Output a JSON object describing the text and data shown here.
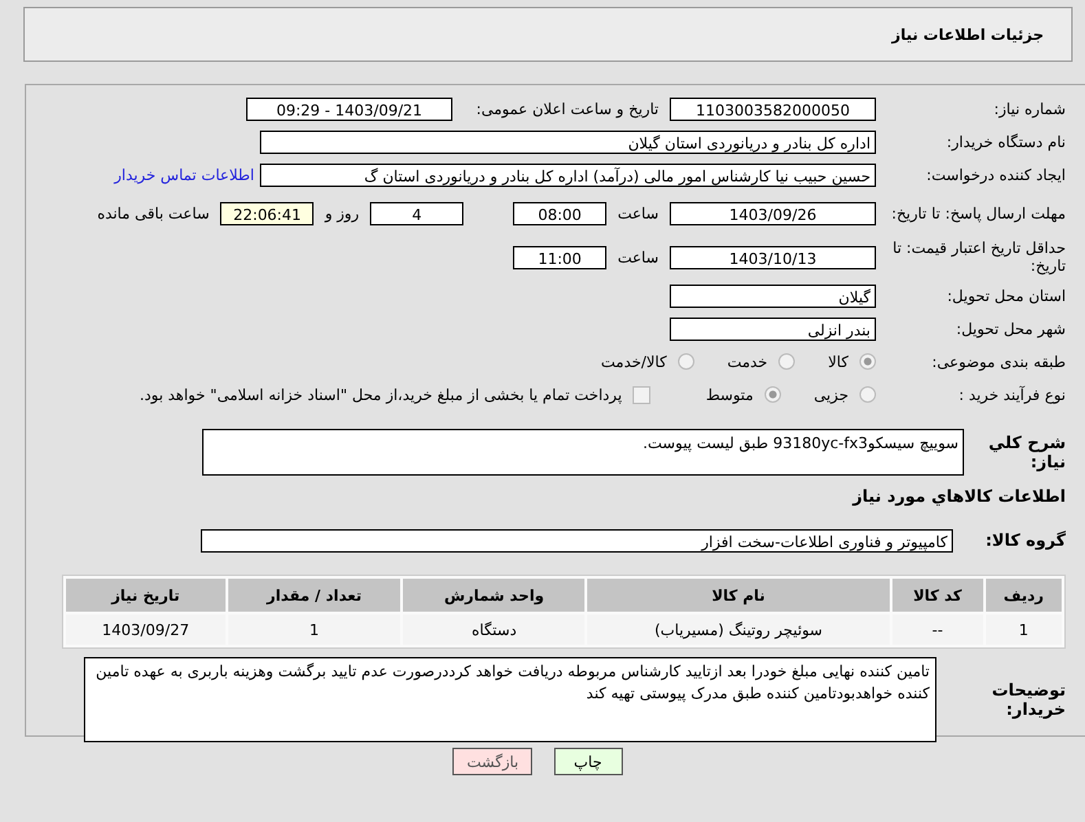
{
  "header": {
    "title": "جزئیات اطلاعات نیاز"
  },
  "fields": {
    "need_number": {
      "label": "شماره نیاز:",
      "value": "1103003582000050"
    },
    "announce": {
      "label": "تاریخ و ساعت اعلان عمومی:",
      "value": "1403/09/21 - 09:29"
    },
    "buyer_org": {
      "label": "نام دستگاه خریدار:",
      "value": "اداره کل بنادر و دریانوردی استان گیلان"
    },
    "creator": {
      "label": "ایجاد کننده درخواست:",
      "value": "حسین حبیب نیا کارشناس امور مالی (درآمد) اداره کل بنادر و دریانوردی استان گ",
      "link": "اطلاعات تماس خریدار"
    },
    "deadline": {
      "label": "مهلت ارسال پاسخ: تا تاریخ:",
      "date": "1403/09/26",
      "time_label": "ساعت",
      "time": "08:00",
      "days": "4",
      "days_label": "روز و",
      "remaining": "22:06:41",
      "remaining_label": "ساعت باقی مانده"
    },
    "validity": {
      "label": "حداقل تاریخ اعتبار قیمت: تا تاریخ:",
      "date": "1403/10/13",
      "time_label": "ساعت",
      "time": "11:00"
    },
    "province": {
      "label": "استان محل تحویل:",
      "value": "گیلان"
    },
    "city": {
      "label": "شهر محل تحویل:",
      "value": "بندر انزلی"
    }
  },
  "category": {
    "label": "طبقه بندی موضوعی:",
    "options": [
      {
        "label": "کالا",
        "selected": true
      },
      {
        "label": "خدمت",
        "selected": false
      },
      {
        "label": "کالا/خدمت",
        "selected": false
      }
    ]
  },
  "process": {
    "label": "نوع فرآیند خرید :",
    "options": [
      {
        "label": "جزیی",
        "selected": false
      },
      {
        "label": "متوسط",
        "selected": true
      }
    ],
    "payment": {
      "label": "پرداخت تمام یا بخشی از مبلغ خرید،از محل \"اسناد خزانه اسلامی\" خواهد بود.",
      "checked": false
    }
  },
  "description": {
    "label": "شرح کلي نياز:",
    "value": "سوییچ سیسکو93180yc-fx3 طبق لیست پیوست."
  },
  "goods_heading": "اطلاعات کالاهاي مورد نياز",
  "goods_group": {
    "label": "گروه کالا:",
    "value": "کامپیوتر و فناوری اطلاعات-سخت افزار"
  },
  "table": {
    "columns": [
      "ردیف",
      "کد کالا",
      "نام کالا",
      "واحد شمارش",
      "تعداد / مقدار",
      "تاریخ نیاز"
    ],
    "rows": [
      [
        "1",
        "--",
        "سوئیچر روتینگ (مسیریاب)",
        "دستگاه",
        "1",
        "1403/09/27"
      ]
    ]
  },
  "buyer_notes": {
    "label": "توضیحات خریدار:",
    "value": "تامین کننده نهایی مبلغ خودرا بعد ازتایید کارشناس مربوطه دریافت خواهد کرددرصورت عدم تایید برگشت وهزینه باربری به عهده تامین کننده خواهدبودتامین کننده طبق مدرک پیوستی تهیه کند"
  },
  "buttons": [
    {
      "label": "چاپ",
      "kind": "print"
    },
    {
      "label": "بازگشت",
      "kind": "back"
    }
  ]
}
